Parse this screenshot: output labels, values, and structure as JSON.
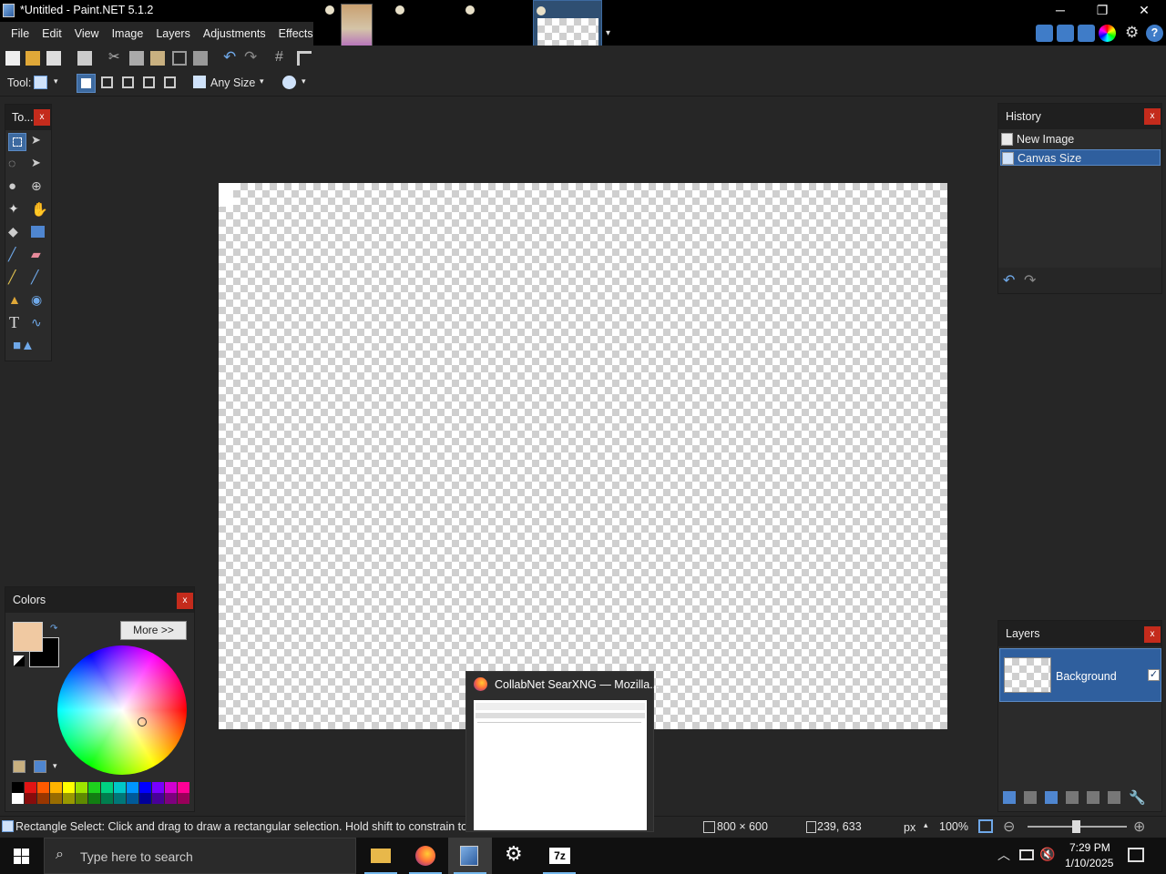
{
  "window": {
    "title": "*Untitled - Paint.NET 5.1.2",
    "minimize": "─",
    "restore": "❐",
    "close": "✕"
  },
  "menu": [
    "File",
    "Edit",
    "View",
    "Image",
    "Layers",
    "Adjustments",
    "Effects"
  ],
  "toolbar_row2": {
    "tool_label": "Tool:",
    "size_mode": "Any Size"
  },
  "tools_panel": {
    "title": "To...",
    "close": "x"
  },
  "history_panel": {
    "title": "History",
    "close": "x",
    "items": [
      {
        "label": "New Image",
        "selected": false
      },
      {
        "label": "Canvas Size",
        "selected": true
      }
    ]
  },
  "layers_panel": {
    "title": "Layers",
    "close": "x",
    "layers": [
      {
        "name": "Background",
        "visible": true
      }
    ]
  },
  "colors_panel": {
    "title": "Colors",
    "close": "x",
    "more_button": "More >>",
    "primary_color": "#f0c9a2",
    "secondary_color": "#000000"
  },
  "palette": [
    "#000000",
    "#e11414",
    "#ff5a00",
    "#ffb400",
    "#ffff00",
    "#9ee600",
    "#1ed21e",
    "#00d282",
    "#00c8c8",
    "#0096ff",
    "#0000ff",
    "#7800ff",
    "#d200d2",
    "#ff0096"
  ],
  "canvas": {
    "width": 800,
    "height": 600
  },
  "statusbar": {
    "hint": "Rectangle Select: Click and drag to draw a rectangular selection. Hold shift to constrain to a sc",
    "image_size": "800 × 600",
    "cursor_pos": "239, 633",
    "unit": "px",
    "zoom": "100%"
  },
  "popup": {
    "title": "CollabNet SearXNG — Mozilla..."
  },
  "taskbar": {
    "search_placeholder": "Type here to search",
    "time": "7:29 PM",
    "date": "1/10/2025",
    "app_7z": "7z"
  }
}
